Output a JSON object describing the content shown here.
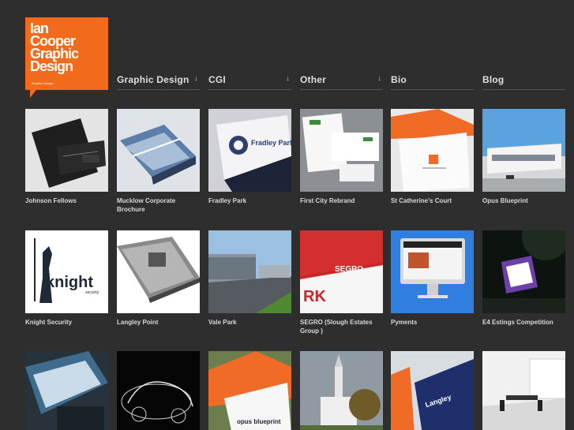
{
  "logo": {
    "lines": [
      "Ian",
      "Cooper",
      "Graphic",
      "Design"
    ],
    "tagline": "Graphic Design"
  },
  "nav": [
    {
      "label": "Graphic Design",
      "has_arrow": true
    },
    {
      "label": "CGI",
      "has_arrow": true
    },
    {
      "label": "Other",
      "has_arrow": true
    },
    {
      "label": "Bio",
      "has_arrow": false
    },
    {
      "label": "Blog",
      "has_arrow": false
    }
  ],
  "nav_arrow_glyph": "↓",
  "projects": [
    {
      "caption": "Johnson Fellows"
    },
    {
      "caption": "Mucklow Corporate Brochure"
    },
    {
      "caption": "Fradley Park"
    },
    {
      "caption": "First City Rebrand"
    },
    {
      "caption": "St Catherine's Court"
    },
    {
      "caption": "Opus Blueprint"
    },
    {
      "caption": "Knight Security"
    },
    {
      "caption": "Langley Point"
    },
    {
      "caption": "Vale Park"
    },
    {
      "caption": "SEGRO (Slough Estates Group )"
    },
    {
      "caption": "Pyments"
    },
    {
      "caption": "E4 Estings Competition"
    },
    {
      "caption": ""
    },
    {
      "caption": ""
    },
    {
      "caption": ""
    },
    {
      "caption": ""
    },
    {
      "caption": ""
    },
    {
      "caption": ""
    }
  ],
  "thumb_text": {
    "fradley": "Fradley Park",
    "knight": "knight",
    "knight_sub": "security",
    "segro": "SEGRO",
    "segro_rk": "RK",
    "opus": "opus blueprint",
    "langley": "Langley"
  },
  "colors": {
    "background": "#2e2e2e",
    "accent": "#f26a1b"
  }
}
